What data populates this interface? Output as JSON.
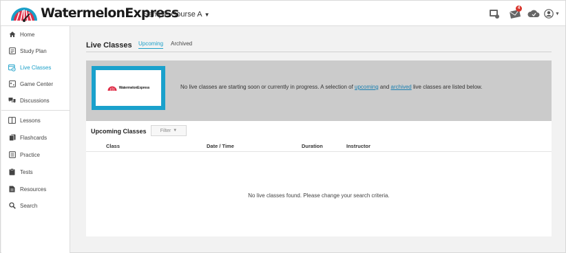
{
  "app": {
    "brand": "WatermelonExpress",
    "course": "Sample Course A",
    "mini_brand": "WatermelonExpress",
    "notification_count": "4"
  },
  "colors": {
    "accent": "#1a9fc8",
    "banner_bg": "#cbcbcb",
    "logo_border": "#1aa1cc",
    "badge": "#d9342b"
  },
  "sidebar": {
    "items": [
      {
        "label": "Home",
        "icon": "home-icon"
      },
      {
        "label": "Study Plan",
        "icon": "study-plan-icon"
      },
      {
        "label": "Live Classes",
        "icon": "live-classes-icon",
        "active": true
      },
      {
        "label": "Game Center",
        "icon": "game-center-icon"
      },
      {
        "label": "Discussions",
        "icon": "discussions-icon"
      },
      {
        "label": "Lessons",
        "icon": "lessons-icon"
      },
      {
        "label": "Flashcards",
        "icon": "flashcards-icon"
      },
      {
        "label": "Practice",
        "icon": "practice-icon"
      },
      {
        "label": "Tests",
        "icon": "tests-icon"
      },
      {
        "label": "Resources",
        "icon": "resources-icon"
      },
      {
        "label": "Search",
        "icon": "search-icon"
      }
    ]
  },
  "main": {
    "title": "Live Classes",
    "tabs": [
      {
        "label": "Upcoming",
        "active": true
      },
      {
        "label": "Archived"
      }
    ],
    "banner": {
      "text_before": "No live classes are starting soon or currently in progress. A selection of ",
      "link_upcoming": "upcoming",
      "text_middle": " and ",
      "link_archived": "archived",
      "text_after": " live classes are listed below."
    },
    "upcoming": {
      "title": "Upcoming Classes",
      "filter_label": "Filter",
      "columns": [
        "Class",
        "Date / Time",
        "Duration",
        "Instructor"
      ],
      "empty_message": "No live classes found. Please change your search criteria."
    }
  }
}
